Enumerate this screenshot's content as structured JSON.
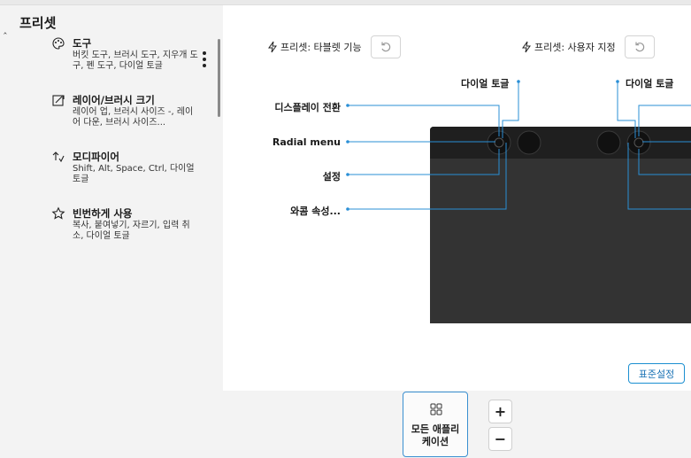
{
  "sidebar": {
    "section_title": "프리셋",
    "presets": [
      {
        "icon": "palette-icon",
        "title": "도구",
        "desc": "버킷 도구, 브러시 도구, 지우개 도구, 펜 도구, 다이얼 토글"
      },
      {
        "icon": "resize-brush-icon",
        "title": "레이어/브러시 크기",
        "desc": "레이어 업, 브러시 사이즈 -, 레이어 다운, 브러시 사이즈..."
      },
      {
        "icon": "modifier-keys-icon",
        "title": "모디파이어",
        "desc": "Shift, Alt, Space, Ctrl, 다이얼 토글"
      },
      {
        "icon": "star-icon",
        "title": "빈번하게 사용",
        "desc": "복사, 붙여넣기, 자르기, 입력 취소, 다이얼 토글"
      }
    ]
  },
  "panel": {
    "preset_tablet": "프리셋: 타블렛 기능",
    "preset_custom": "프리셋: 사용자 지정",
    "labels": {
      "dial_toggle_left": "다이얼 토글",
      "dial_toggle_right": "다이얼 토글",
      "display_toggle": "디스플레이 전환",
      "radial_menu": "Radial menu",
      "settings": "설정",
      "wacom_props": "와콤 속성..."
    },
    "default_button": "표준설정"
  },
  "bottom": {
    "all_apps_line1": "모든 애플리",
    "all_apps_line2": "케이션",
    "zoom_in": "+",
    "zoom_out": "−"
  },
  "colors": {
    "accent": "#1b8fd1",
    "callout": "#2a8fd6",
    "tablet": "#2a2a2a"
  }
}
